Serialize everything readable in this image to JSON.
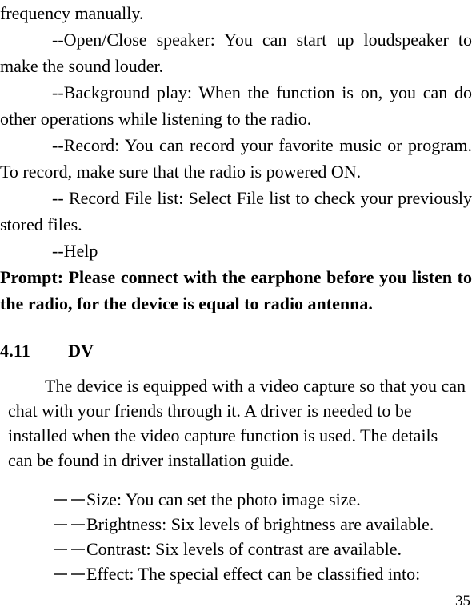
{
  "document": {
    "page_number": "35",
    "paragraphs": [
      {
        "id": "runover",
        "style": "continuation",
        "text": "frequency manually."
      },
      {
        "id": "open-close-speaker",
        "style": "indented-justified",
        "text": "--Open/Close speaker: You can start up loudspeaker to make the sound louder."
      },
      {
        "id": "background-play",
        "style": "indented-justified",
        "text": "--Background play: When the function is on, you can do other operations while listening to the radio."
      },
      {
        "id": "record",
        "style": "indented-justified",
        "text": "--Record: You can record your favorite music or program. To record, make sure that the radio is powered ON."
      },
      {
        "id": "record-file-list",
        "style": "indented-justified",
        "text": "-- Record File list: Select File list to check your previously stored files."
      },
      {
        "id": "help",
        "style": "indented-short",
        "text": "--Help"
      },
      {
        "id": "prompt",
        "style": "bold-justified",
        "text": "Prompt: Please connect with the earphone before you listen to the radio, for the device is equal to radio antenna."
      }
    ],
    "heading": {
      "number": "4.11",
      "title": "DV"
    },
    "section_intro": "The device is equipped with a video capture so that you can chat with your friends through it. A driver is needed to be installed when the video capture function is used. The details can be found in driver installation guide.",
    "list": {
      "marker": "－－",
      "items": [
        {
          "text": "Size: You can set the photo image size."
        },
        {
          "text": "Brightness: Six levels of brightness are available."
        },
        {
          "text": "Contrast: Six levels of contrast are available."
        },
        {
          "text": "Effect: The special effect can be classified into:"
        }
      ]
    }
  }
}
